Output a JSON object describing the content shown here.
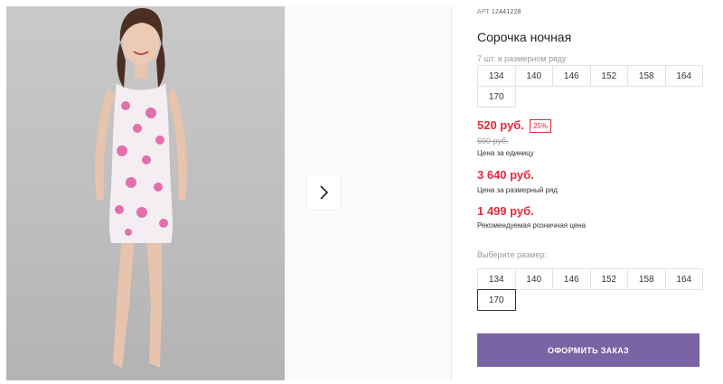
{
  "product": {
    "art_label": "АРТ",
    "art_number": "12441228",
    "title": "Сорочка ночная",
    "size_note": "7 шт. в размерном ряду",
    "sizes_row": [
      "134",
      "140",
      "146",
      "152",
      "158",
      "164",
      "170"
    ],
    "price": "520 руб.",
    "discount": "25%",
    "old_price": "690 руб.",
    "price_label": "Цена за единицу",
    "row_price": "3 640 руб.",
    "row_price_label": "Цена за размерный ряд",
    "retail_price": "1 499 руб.",
    "retail_label": "Рекомендуемая розничная цена",
    "choose_size_label": "Выберите размер:",
    "size_options": [
      "134",
      "140",
      "146",
      "152",
      "158",
      "164",
      "170"
    ],
    "selected_size": "170",
    "order_button": "ОФОРМИТЬ ЗАКАЗ"
  },
  "gallery": {
    "next_icon": "chevron-right-icon"
  },
  "colors": {
    "accent": "#7b64a3",
    "price": "#e32a3a"
  }
}
